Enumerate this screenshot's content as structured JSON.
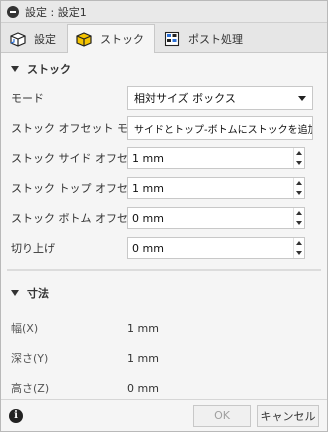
{
  "window": {
    "title": "設定 : 設定1"
  },
  "tabs": [
    {
      "label": "設定",
      "icon": "setup-cube-icon",
      "active": false
    },
    {
      "label": "ストック",
      "icon": "stock-box-icon",
      "active": true
    },
    {
      "label": "ポスト処理",
      "icon": "post-process-icon",
      "active": false
    }
  ],
  "stock_section": {
    "header": "ストック",
    "mode": {
      "label": "モード",
      "value": "相対サイズ ボックス"
    },
    "offset_mode": {
      "label": "ストック オフセット モード",
      "value": "サイドとトップ-ボトムにストックを追加"
    },
    "side_offset": {
      "label": "ストック サイド オフセット",
      "value": "1 mm"
    },
    "top_offset": {
      "label": "ストック トップ オフセット",
      "value": "1 mm"
    },
    "bottom_offset": {
      "label": "ストック ボトム オフセット",
      "value": "0 mm"
    },
    "round_up": {
      "label": "切り上げ",
      "value": "0 mm"
    }
  },
  "dimensions_section": {
    "header": "寸法",
    "width": {
      "label": "幅(X)",
      "value": "1 mm"
    },
    "depth": {
      "label": "深さ(Y)",
      "value": "1 mm"
    },
    "height": {
      "label": "高さ(Z)",
      "value": "0 mm"
    }
  },
  "footer": {
    "info_icon": "i",
    "ok_label": "OK",
    "cancel_label": "キャンセル"
  },
  "colors": {
    "dialog_bg": "#f5f5f5",
    "tab_bar_bg": "#e6e6e6",
    "ok_disabled_text": "#a0a0a0",
    "stock_icon_yellow": "#f5c400"
  }
}
